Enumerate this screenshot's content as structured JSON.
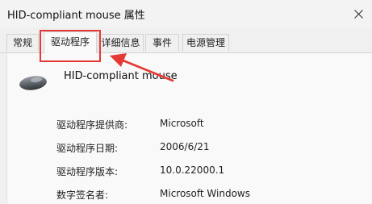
{
  "window": {
    "title": "HID-compliant mouse 属性"
  },
  "tabs": [
    {
      "label": "常规",
      "active": false
    },
    {
      "label": "驱动程序",
      "active": true
    },
    {
      "label": "详细信息",
      "active": false
    },
    {
      "label": "事件",
      "active": false
    },
    {
      "label": "电源管理",
      "active": false
    }
  ],
  "device": {
    "name": "HID-compliant mouse",
    "icon": "mouse-icon"
  },
  "properties": [
    {
      "label": "驱动程序提供商:",
      "value": "Microsoft"
    },
    {
      "label": "驱动程序日期:",
      "value": "2006/6/21"
    },
    {
      "label": "驱动程序版本:",
      "value": "10.0.22000.1"
    },
    {
      "label": "数字签名者:",
      "value": "Microsoft Windows"
    }
  ],
  "colors": {
    "annotation": "#e53935"
  }
}
